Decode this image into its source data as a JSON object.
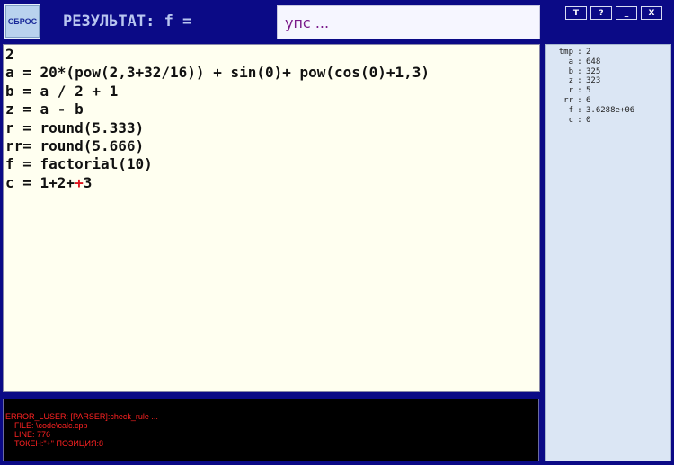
{
  "toolbar": {
    "reset_label": "СБРОС",
    "result_label": "РЕЗУЛЬТАТ: f =",
    "result_value": "упс ...",
    "window_buttons": [
      "T",
      "?",
      "_",
      "X"
    ]
  },
  "editor": {
    "lines": [
      "2",
      "a = 20*(pow(2,3+32/16)) + sin(0)+ pow(cos(0)+1,3)",
      "b = a / 2 + 1",
      "z = a - b",
      "r = round(5.333)",
      "rr= round(5.666)",
      "f = factorial(10)",
      "c = 1+2++3"
    ],
    "error_line_prefix": "c = 1+2+",
    "error_char": "+",
    "error_line_suffix": "3"
  },
  "console": {
    "lines": [
      "ERROR_LUSER: [PARSER]:check_rule ...",
      "    FILE: \\code\\calc.cpp",
      "    LINE: 776",
      "    ТОКЕН:\"+\" ПОЗИЦИЯ:8"
    ]
  },
  "variables": [
    {
      "name": "tmp",
      "value": "2"
    },
    {
      "name": "a",
      "value": "648"
    },
    {
      "name": "b",
      "value": "325"
    },
    {
      "name": "z",
      "value": "323"
    },
    {
      "name": "r",
      "value": "5"
    },
    {
      "name": "rr",
      "value": "6"
    },
    {
      "name": "f",
      "value": "3.6288e+06"
    },
    {
      "name": "c",
      "value": "0"
    }
  ],
  "colors": {
    "background": "#0b0a86",
    "editor_bg": "#fffff0",
    "error_red": "#e0141e",
    "vars_bg": "#dbe6f4"
  }
}
